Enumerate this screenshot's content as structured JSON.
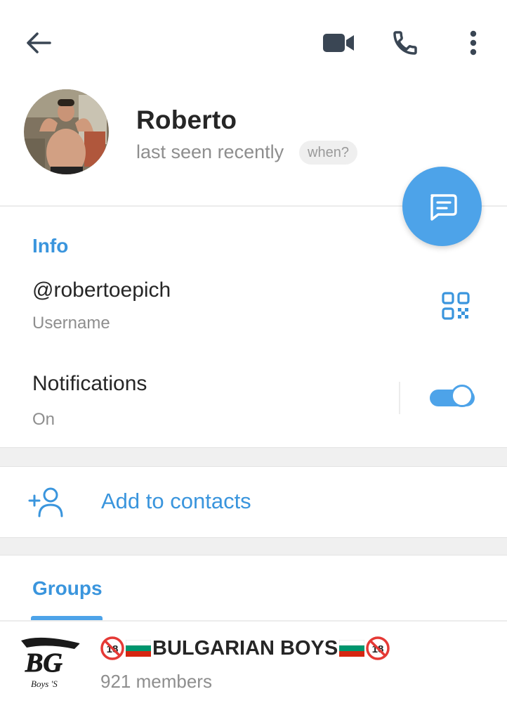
{
  "header": {
    "back_icon": "arrow-left-icon",
    "video_icon": "video-camera-icon",
    "call_icon": "phone-icon",
    "more_icon": "more-vertical-icon"
  },
  "profile": {
    "name": "Roberto",
    "status": "last seen recently",
    "when_label": "when?"
  },
  "fab": {
    "icon": "message-icon"
  },
  "info": {
    "title": "Info",
    "username": "@robertoepich",
    "username_label": "Username",
    "qr_icon": "qr-code-icon",
    "notifications_title": "Notifications",
    "notifications_value": "On",
    "notifications_enabled": true
  },
  "contacts": {
    "add_label": "Add to contacts",
    "icon": "add-user-icon"
  },
  "groups": {
    "tab_label": "Groups",
    "items": [
      {
        "name": "BULGARIAN BOYS",
        "members": "921 members",
        "avatar_text": "Boys 'S",
        "avatar_logo": "BG"
      }
    ]
  },
  "colors": {
    "accent": "#4da3e9",
    "accent_text": "#3a95dd",
    "icon_dark": "#3a4654"
  }
}
